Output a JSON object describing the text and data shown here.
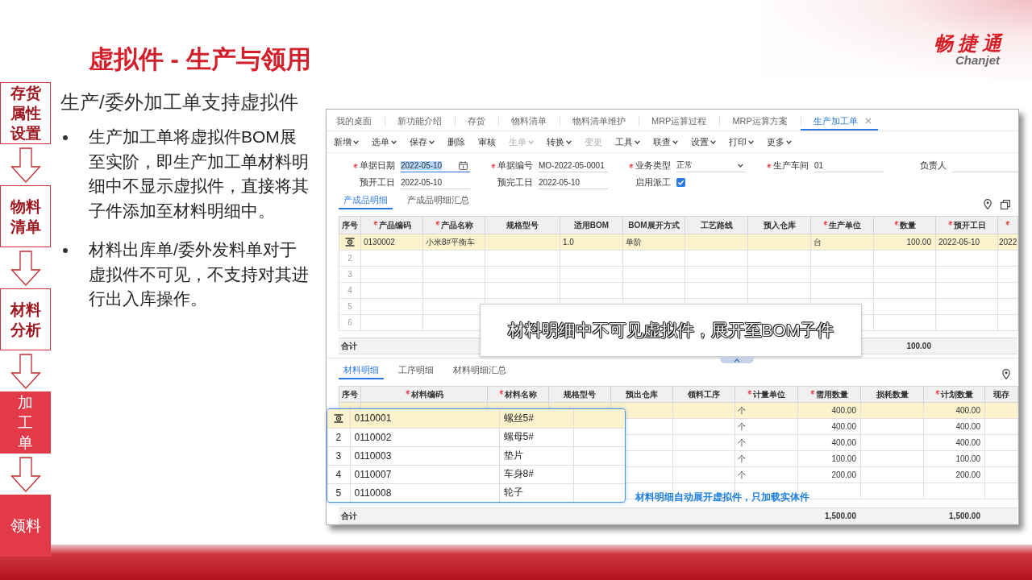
{
  "slide": {
    "title": "虚拟件 - 生产与领用",
    "logo": {
      "mark": "畅捷通",
      "wordmark": "Chanjet"
    }
  },
  "flow": [
    {
      "label": "存货属性设置",
      "kind": "outline"
    },
    {
      "label": "物料清单",
      "kind": "outline"
    },
    {
      "label": "材料分析",
      "kind": "outline"
    },
    {
      "label": "加工单",
      "kind": "vertical"
    },
    {
      "label": "领料",
      "kind": "solid"
    }
  ],
  "intro": {
    "heading": "生产/委外加工单支持虚拟件",
    "bullets": [
      "生产加工单将虚拟件BOM展至实阶，即生产加工单材料明细中不显示虚拟件，直接将其子件添加至材料明细中。",
      "材料出库单/委外发料单对于虚拟件不可见，不支持对其进行出入库操作。"
    ]
  },
  "app": {
    "tabs": [
      {
        "label": "我的桌面",
        "selected": false
      },
      {
        "label": "新功能介绍",
        "selected": false
      },
      {
        "label": "存货",
        "selected": false
      },
      {
        "label": "物料清单",
        "selected": false
      },
      {
        "label": "物料清单维护",
        "selected": false
      },
      {
        "label": "MRP运算过程",
        "selected": false
      },
      {
        "label": "MRP运算方案",
        "selected": false
      },
      {
        "label": "生产加工单",
        "selected": true
      }
    ],
    "toolbar": [
      {
        "label": "新增",
        "menu": true,
        "disabled": false
      },
      {
        "label": "选单",
        "menu": true,
        "disabled": false
      },
      {
        "label": "保存",
        "menu": true,
        "disabled": false
      },
      {
        "label": "删除",
        "menu": false,
        "disabled": false
      },
      {
        "label": "审核",
        "menu": false,
        "disabled": false
      },
      {
        "label": "生单",
        "menu": true,
        "disabled": true
      },
      {
        "label": "转换",
        "menu": true,
        "disabled": false
      },
      {
        "label": "变更",
        "menu": false,
        "disabled": true
      },
      {
        "label": "工具",
        "menu": true,
        "disabled": false
      },
      {
        "label": "联查",
        "menu": true,
        "disabled": false
      },
      {
        "label": "设置",
        "menu": true,
        "disabled": false
      },
      {
        "label": "打印",
        "menu": true,
        "disabled": false
      },
      {
        "label": "更多",
        "menu": true,
        "disabled": false
      }
    ],
    "form": [
      {
        "label": "单据日期",
        "required": true,
        "kind": "date",
        "value": "2022-05-10",
        "focused": true
      },
      {
        "label": "单据编号",
        "required": true,
        "kind": "text",
        "value": "MO-2022-05-0001",
        "focused": false
      },
      {
        "label": "业务类型",
        "required": true,
        "kind": "select",
        "value": "正常",
        "focused": false
      },
      {
        "label": "生产车间",
        "required": true,
        "kind": "text",
        "value": "01",
        "focused": false
      },
      {
        "label": "负责人",
        "required": false,
        "kind": "text",
        "focused": false
      },
      {
        "label": "预开工日",
        "required": false,
        "kind": "text",
        "value": "2022-05-10",
        "focused": false
      },
      {
        "label": "预完工日",
        "required": false,
        "kind": "text",
        "value": "2022-05-10",
        "focused": false
      },
      {
        "label": "启用派工",
        "required": false,
        "kind": "checkbox",
        "checked": true,
        "focused": false
      }
    ],
    "product_section": {
      "tabs": [
        {
          "label": "产成品明细",
          "selected": true
        },
        {
          "label": "产成品明细汇总",
          "selected": false
        }
      ],
      "columns": [
        {
          "label": "序号",
          "required": false,
          "kind": "index"
        },
        {
          "label": "产品编码",
          "required": true,
          "kind": "text"
        },
        {
          "label": "产品名称",
          "required": true,
          "kind": "text"
        },
        {
          "label": "规格型号",
          "required": false,
          "kind": "text"
        },
        {
          "label": "适用BOM",
          "required": false,
          "kind": "text"
        },
        {
          "label": "BOM展开方式",
          "required": false,
          "kind": "text"
        },
        {
          "label": "工艺路线",
          "required": false,
          "kind": "text"
        },
        {
          "label": "预入仓库",
          "required": false,
          "kind": "text"
        },
        {
          "label": "生产单位",
          "required": true,
          "kind": "text"
        },
        {
          "label": "数量",
          "required": true,
          "kind": "number"
        },
        {
          "label": "预开工日",
          "required": true,
          "kind": "text"
        },
        {
          "required": true,
          "kind": "text"
        }
      ],
      "rows": [
        {
          "current": true,
          "selected": true,
          "cells": [
            "0130002",
            "小米8#平衡车",
            null,
            "1.0",
            "单阶",
            null,
            null,
            "台",
            "100.00",
            "2022-05-10",
            "2022"
          ]
        },
        {
          "no": "2",
          "current": false,
          "selected": false
        },
        {
          "no": "3",
          "current": false,
          "selected": false
        },
        {
          "no": "4",
          "current": false,
          "selected": false
        },
        {
          "no": "5",
          "current": false,
          "selected": false
        },
        {
          "no": "6",
          "current": false,
          "selected": false
        }
      ],
      "totals": {
        "label": "合计",
        "cells": [
          null,
          null,
          null,
          null,
          null,
          null,
          null,
          null,
          "100.00",
          null,
          null
        ]
      }
    },
    "callout": "材料明细中不可见虚拟件，展开至BOM子件",
    "material_section": {
      "tabs": [
        {
          "label": "材料明细",
          "selected": true
        },
        {
          "label": "工序明细",
          "selected": false
        },
        {
          "label": "材料明细汇总",
          "selected": false
        }
      ],
      "columns": [
        {
          "label": "序号",
          "required": false,
          "kind": "index"
        },
        {
          "label": "材料编码",
          "required": true,
          "kind": "text"
        },
        {
          "label": "材料名称",
          "required": true,
          "kind": "text"
        },
        {
          "label": "规格型号",
          "required": false,
          "kind": "text"
        },
        {
          "label": "预出仓库",
          "required": false,
          "kind": "text"
        },
        {
          "label": "领料工序",
          "required": false,
          "kind": "text"
        },
        {
          "label": "计量单位",
          "required": true,
          "kind": "text"
        },
        {
          "label": "需用数量",
          "required": true,
          "kind": "number"
        },
        {
          "label": "损耗数量",
          "required": false,
          "kind": "number"
        },
        {
          "label": "计划数量",
          "required": true,
          "kind": "number"
        },
        {
          "label": "现存",
          "required": false,
          "kind": "text"
        }
      ],
      "rows": [
        {
          "selected": true,
          "cells": [
            null,
            null,
            null,
            null,
            null,
            "个",
            "400.00",
            null,
            "400.00",
            null
          ]
        },
        {
          "selected": false,
          "cells": [
            null,
            null,
            null,
            null,
            null,
            "个",
            "400.00",
            null,
            "400.00",
            null
          ]
        },
        {
          "selected": false,
          "cells": [
            null,
            null,
            null,
            null,
            null,
            "个",
            "400.00",
            null,
            "400.00",
            null
          ]
        },
        {
          "selected": false,
          "cells": [
            null,
            null,
            null,
            null,
            null,
            "个",
            "100.00",
            null,
            "100.00",
            null
          ]
        },
        {
          "selected": false,
          "cells": [
            null,
            null,
            null,
            null,
            null,
            "个",
            "200.00",
            null,
            "200.00",
            null
          ]
        },
        {
          "selected": false
        }
      ],
      "totals": {
        "label": "合计",
        "cells": [
          null,
          null,
          null,
          null,
          null,
          null,
          "1,500.00",
          null,
          "1,500.00",
          null
        ]
      }
    },
    "inset": {
      "rows": [
        {
          "current": true,
          "selected": true,
          "cells": [
            "0110001",
            "螺丝5#"
          ]
        },
        {
          "no": "2",
          "current": false,
          "selected": false,
          "cells": [
            "0110002",
            "螺母5#"
          ]
        },
        {
          "no": "3",
          "current": false,
          "selected": false,
          "cells": [
            "0110003",
            "垫片"
          ]
        },
        {
          "no": "4",
          "current": false,
          "selected": false,
          "cells": [
            "0110007",
            "车身8#"
          ]
        },
        {
          "no": "5",
          "current": false,
          "selected": false,
          "cells": [
            "0110008",
            "轮子"
          ]
        }
      ]
    },
    "annotation": "材料明细自动展开虚拟件，只加载实体件"
  }
}
